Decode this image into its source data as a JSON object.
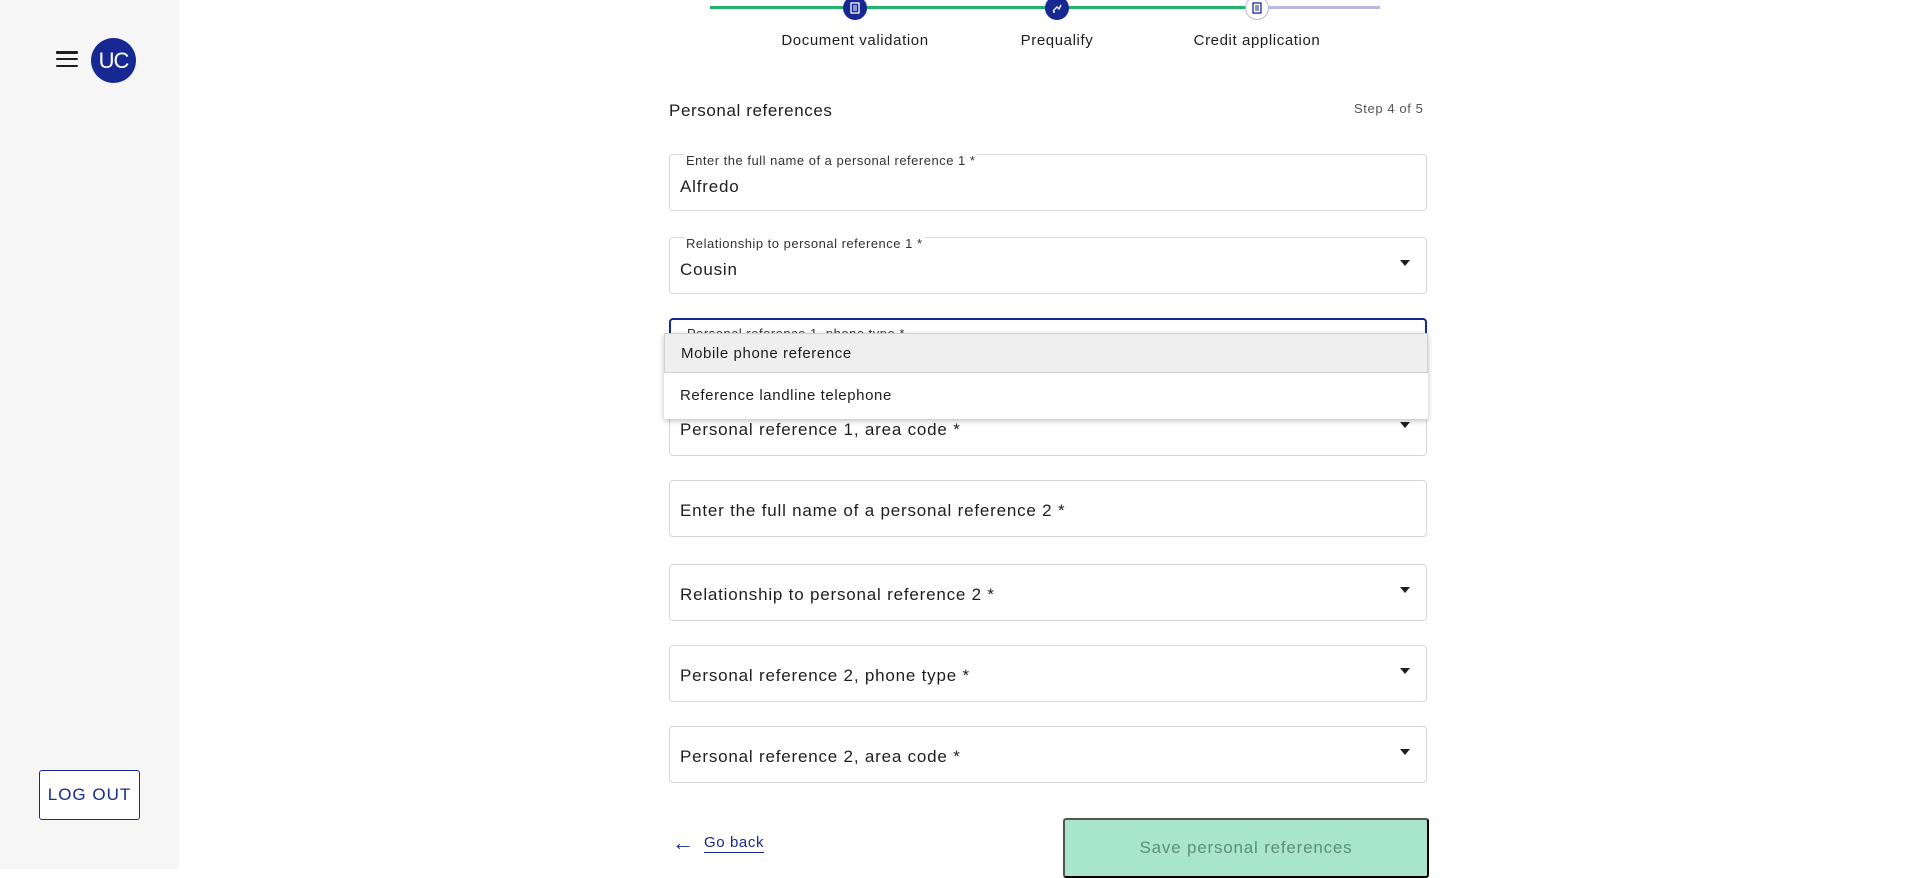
{
  "sidebar": {
    "avatar_text": "UC",
    "logout_label": "LOG OUT"
  },
  "stepper": {
    "steps": [
      {
        "label": "Document validation",
        "state": "done",
        "icon": "document-icon"
      },
      {
        "label": "Prequalify",
        "state": "done",
        "icon": "signature-icon"
      },
      {
        "label": "Credit application",
        "state": "current",
        "icon": "form-icon"
      }
    ],
    "colors": {
      "done": "#24b36b",
      "todo": "#b7b9de",
      "dot": "#172893"
    }
  },
  "section": {
    "title": "Personal references",
    "step_count": "Step 4 of 5"
  },
  "fields": {
    "ref1_name": {
      "label": "Enter the full name of a personal reference 1 *",
      "value": "Alfredo"
    },
    "ref1_relationship": {
      "label": "Relationship to personal reference 1 *",
      "value": "Cousin"
    },
    "ref1_phone_type": {
      "label": "Personal reference 1, phone type *"
    },
    "ref1_area_code": {
      "placeholder": "Personal reference 1, area code *"
    },
    "ref2_name": {
      "placeholder": "Enter the full name of a personal reference 2 *"
    },
    "ref2_relationship": {
      "placeholder": "Relationship to personal reference 2 *"
    },
    "ref2_phone_type": {
      "placeholder": "Personal reference 2, phone type *"
    },
    "ref2_area_code": {
      "placeholder": "Personal reference 2, area code *"
    }
  },
  "phone_type_options": [
    "Mobile phone reference",
    "Reference landline telephone"
  ],
  "actions": {
    "go_back": "Go back",
    "save": "Save personal references"
  },
  "colors": {
    "primary": "#172893",
    "success": "#24b36b",
    "save_disabled_bg": "#a8e6cb"
  }
}
